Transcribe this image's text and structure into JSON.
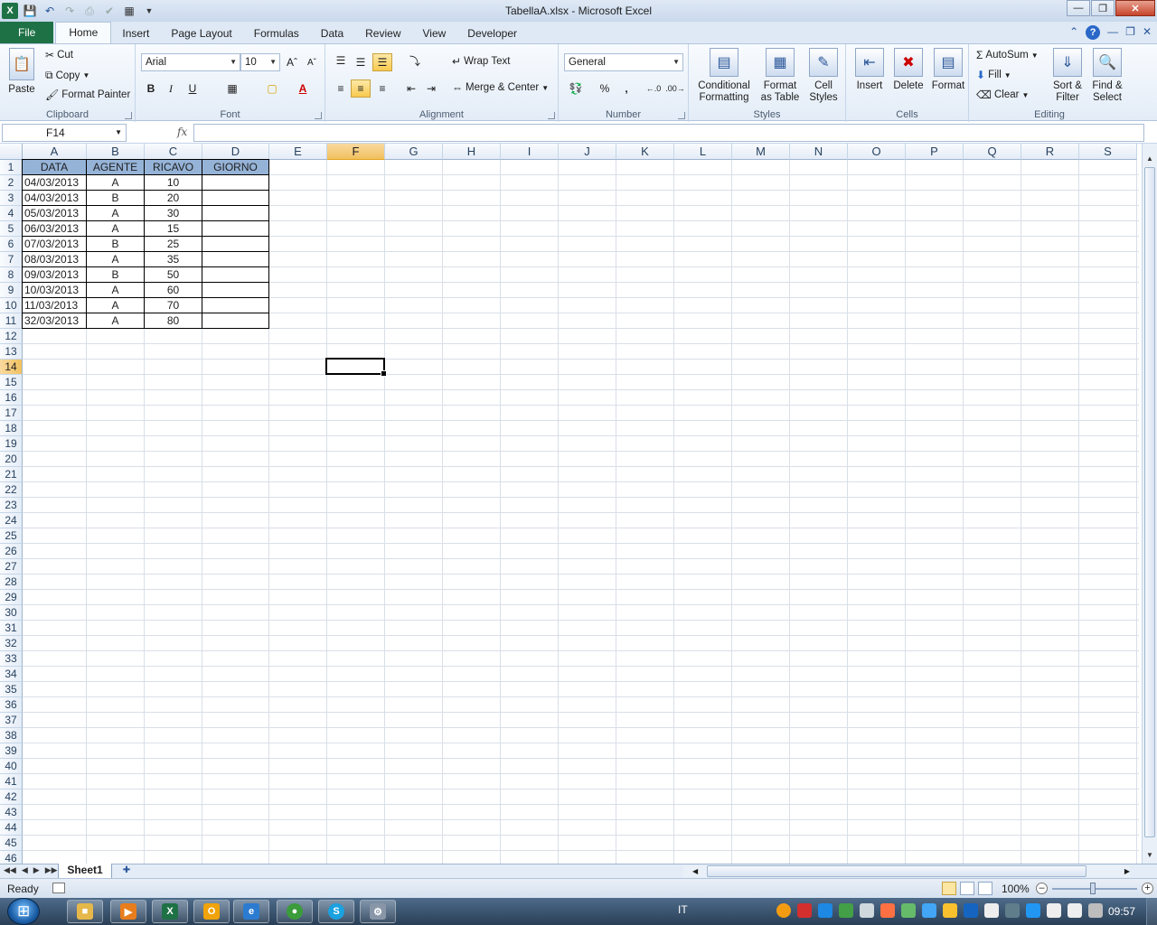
{
  "window": {
    "title": "TabellaA.xlsx - Microsoft Excel"
  },
  "tabs": [
    {
      "label": "File"
    },
    {
      "label": "Home"
    },
    {
      "label": "Insert"
    },
    {
      "label": "Page Layout"
    },
    {
      "label": "Formulas"
    },
    {
      "label": "Data"
    },
    {
      "label": "Review"
    },
    {
      "label": "View"
    },
    {
      "label": "Developer"
    }
  ],
  "ribbon": {
    "clipboard": {
      "group": "Clipboard",
      "paste": "Paste",
      "cut": "Cut",
      "copy": "Copy",
      "format_painter": "Format Painter"
    },
    "font": {
      "group": "Font",
      "name": "Arial",
      "size": "10",
      "bold": "B",
      "italic": "I",
      "underline": "U"
    },
    "alignment": {
      "group": "Alignment",
      "wrap_text": "Wrap Text",
      "merge_center": "Merge & Center"
    },
    "number": {
      "group": "Number",
      "format": "General",
      "percent": "%",
      "comma": ","
    },
    "styles": {
      "group": "Styles",
      "conditional_1": "Conditional",
      "conditional_2": "Formatting",
      "format_table_1": "Format",
      "format_table_2": "as Table",
      "cell_styles_1": "Cell",
      "cell_styles_2": "Styles"
    },
    "cells": {
      "group": "Cells",
      "insert": "Insert",
      "delete": "Delete",
      "format": "Format"
    },
    "editing": {
      "group": "Editing",
      "autosum": "AutoSum",
      "fill": "Fill",
      "clear": "Clear",
      "sort_1": "Sort &",
      "sort_2": "Filter",
      "find_1": "Find &",
      "find_2": "Select"
    }
  },
  "formula_bar": {
    "name_box": "F14",
    "fx": "fx",
    "formula": ""
  },
  "columns": [
    "A",
    "B",
    "C",
    "D",
    "E",
    "F",
    "G",
    "H",
    "I",
    "J",
    "K",
    "L",
    "M",
    "N",
    "O",
    "P",
    "Q",
    "R",
    "S"
  ],
  "selected_column": "F",
  "selected_row": 14,
  "rows": [
    "1",
    "2",
    "3",
    "4",
    "5",
    "6",
    "7",
    "8",
    "9",
    "10",
    "11",
    "12",
    "13",
    "14",
    "15",
    "16",
    "17",
    "18",
    "19",
    "20",
    "21",
    "22",
    "23",
    "24",
    "25",
    "26",
    "27",
    "28",
    "29",
    "30",
    "31",
    "32",
    "33",
    "34",
    "35",
    "36",
    "37",
    "38",
    "39",
    "40",
    "41",
    "42",
    "43",
    "44",
    "45",
    "46"
  ],
  "table": {
    "headers": [
      "DATA",
      "AGENTE",
      "RICAVO",
      "GIORNO"
    ],
    "rows": [
      [
        "04/03/2013",
        "A",
        "10",
        ""
      ],
      [
        "04/03/2013",
        "B",
        "20",
        ""
      ],
      [
        "05/03/2013",
        "A",
        "30",
        ""
      ],
      [
        "06/03/2013",
        "A",
        "15",
        ""
      ],
      [
        "07/03/2013",
        "B",
        "25",
        ""
      ],
      [
        "08/03/2013",
        "A",
        "35",
        ""
      ],
      [
        "09/03/2013",
        "B",
        "50",
        ""
      ],
      [
        "10/03/2013",
        "A",
        "60",
        ""
      ],
      [
        "11/03/2013",
        "A",
        "70",
        ""
      ],
      [
        "32/03/2013",
        "A",
        "80",
        ""
      ]
    ]
  },
  "sheet_tabs": [
    {
      "label": "Sheet1"
    }
  ],
  "status": {
    "ready": "Ready",
    "zoom": "100%"
  },
  "taskbar": {
    "language": "IT",
    "clock": "09:57"
  },
  "colors": {
    "accent": "#1e7145",
    "header_fill": "#95b3d7"
  }
}
